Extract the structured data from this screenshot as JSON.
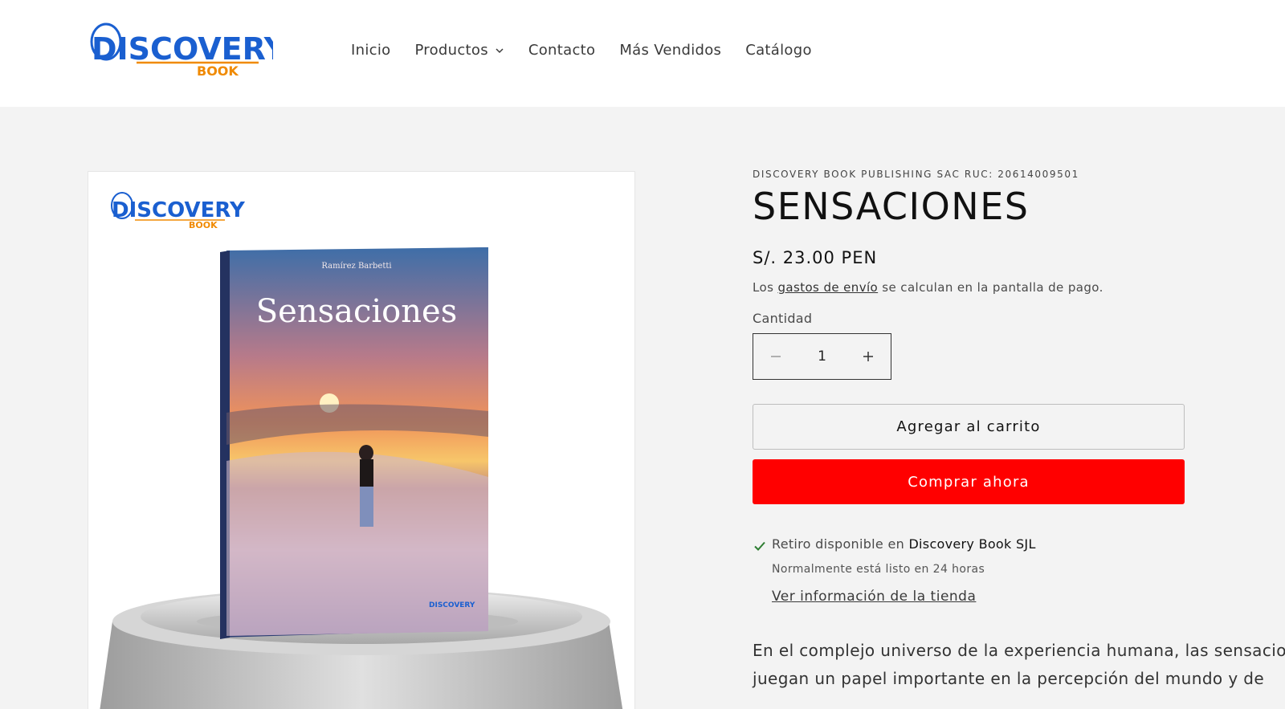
{
  "header": {
    "logo_main": "DISCOVERY",
    "logo_sub": "BOOK",
    "nav": [
      {
        "label": "Inicio"
      },
      {
        "label": "Productos"
      },
      {
        "label": "Contacto"
      },
      {
        "label": "Más Vendidos"
      },
      {
        "label": "Catálogo"
      }
    ]
  },
  "media": {
    "logo_main": "DISCOVERY",
    "logo_sub": "BOOK",
    "book_author": "Ramírez Barbetti",
    "book_title": "Sensaciones",
    "spine_logo": "DISCOVERY"
  },
  "product": {
    "vendor": "DISCOVERY BOOK PUBLISHING SAC RUC: 20614009501",
    "title": "SENSACIONES",
    "price": "S/. 23.00 PEN",
    "shipping_prefix": "Los ",
    "shipping_link": "gastos de envío",
    "shipping_suffix": " se calculan en la pantalla de pago.",
    "quantity_label": "Cantidad",
    "quantity_value": "1",
    "add_to_cart": "Agregar al carrito",
    "buy_now": "Comprar ahora",
    "pickup_prefix": "Retiro disponible en ",
    "pickup_store": "Discovery Book SJL",
    "pickup_time": "Normalmente está listo en 24 horas",
    "store_info_link": "Ver información de la tienda",
    "description_line1": "En el complejo universo de la experiencia humana, las sensacio",
    "description_line2": "juegan un papel importante en la percepción del mundo y de"
  },
  "colors": {
    "accent": "#ff0000",
    "logo_blue": "#1a5fd0",
    "logo_orange": "#f08a00",
    "check_green": "#2e7d32"
  },
  "icons": {
    "nav_dropdown": "chevron-down-icon",
    "quantity_minus": "minus-icon",
    "quantity_plus": "plus-icon",
    "pickup_status": "check-icon"
  }
}
